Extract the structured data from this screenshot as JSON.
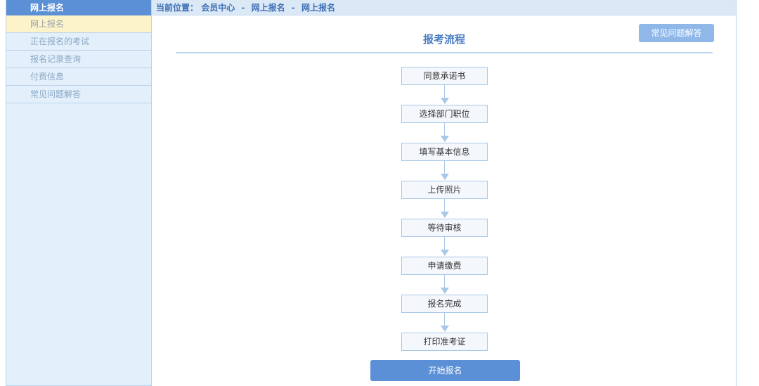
{
  "sidebar": {
    "header": "网上报名",
    "items": [
      {
        "label": "网上报名"
      },
      {
        "label": "正在报名的考试"
      },
      {
        "label": "报名记录查询"
      },
      {
        "label": "付费信息"
      },
      {
        "label": "常见问题解答"
      }
    ]
  },
  "breadcrumb": {
    "prefix": "当前位置：",
    "parts": [
      "会员中心",
      "网上报名",
      "网上报名"
    ],
    "separator": "-"
  },
  "main": {
    "faq_button": "常见问题解答",
    "title": "报考流程",
    "steps": [
      "同意承诺书",
      "选择部门职位",
      "填写基本信息",
      "上传照片",
      "等待审核",
      "申请缴费",
      "报名完成",
      "打印准考证"
    ],
    "start_button": "开始报名"
  },
  "colors": {
    "accent": "#5b8fd6",
    "sidebar_bg": "#e3f0fb",
    "active_item_bg": "#fdf3c9",
    "border": "#b9d3ea"
  }
}
